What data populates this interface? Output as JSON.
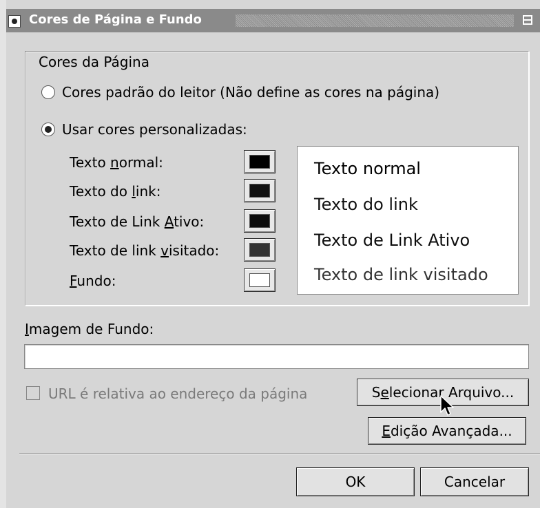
{
  "title_bar": {
    "title": "Cores de Página e Fundo",
    "menu_icon": "window-menu-icon",
    "restore_icon": "window-restore-icon"
  },
  "page_colors": {
    "legend": "Cores da Página",
    "option_default": "Cores padrão do leitor (Não define as cores na página)",
    "option_custom": "Usar cores personalizadas:",
    "selected_option": "custom",
    "rows": [
      {
        "pre": "Texto ",
        "mnemonic": "n",
        "post": "ormal:",
        "color": "#000000"
      },
      {
        "pre": "Texto do ",
        "mnemonic": "l",
        "post": "ink:",
        "color": "#111111"
      },
      {
        "pre": "Texto de Link ",
        "mnemonic": "A",
        "post": "tivo:",
        "color": "#0d0d0d"
      },
      {
        "pre": "Texto de link ",
        "mnemonic": "v",
        "post": "isitado:",
        "color": "#333333"
      },
      {
        "pre": "",
        "mnemonic": "F",
        "post": "undo:",
        "color": "#ffffff"
      }
    ]
  },
  "preview": {
    "normal": "Texto normal",
    "link": "Texto do link",
    "active": "Texto de Link Ativo",
    "visited": "Texto de link visitado",
    "normal_color": "#000000",
    "link_color": "#111111",
    "active_color": "#0d0d0d",
    "visited_color": "#333333",
    "background": "#ffffff"
  },
  "background_image": {
    "label_mnemonic": "I",
    "label_rest": "magem de Fundo:",
    "value": "",
    "relative_checkbox_label": "URL é relativa ao endereço da página",
    "relative_checked": false,
    "select_file_pre": "S",
    "select_file_mnemonic": "e",
    "select_file_post": "lecionar Arquivo...",
    "advanced_mnemonic": "E",
    "advanced_post": "dição Avançada..."
  },
  "footer": {
    "ok": "OK",
    "cancel": "Cancelar"
  }
}
